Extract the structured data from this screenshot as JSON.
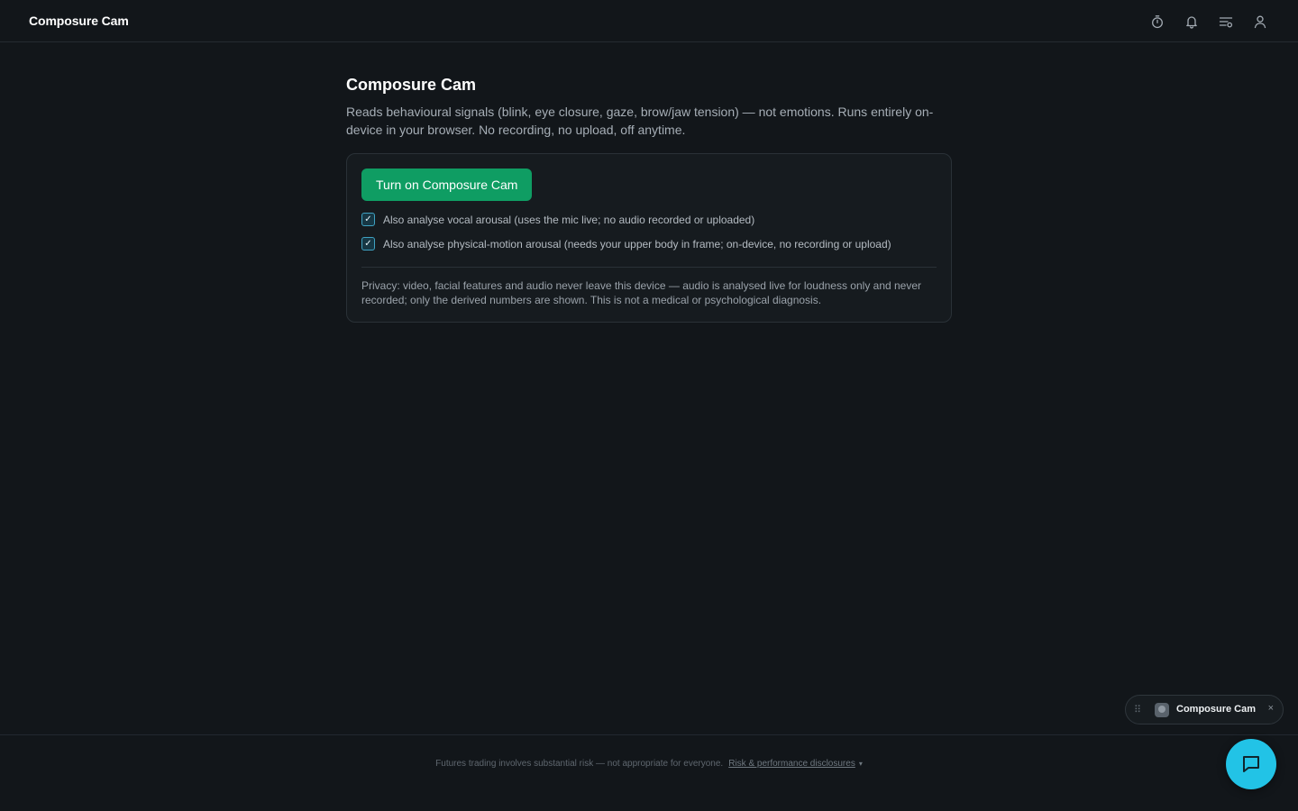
{
  "header": {
    "app_title": "Composure Cam",
    "icons": [
      "timer-icon",
      "bell-icon",
      "list-settings-icon",
      "user-icon"
    ]
  },
  "main": {
    "title": "Composure Cam",
    "description": "Reads behavioural signals (blink, eye closure, gaze, brow/jaw tension) — not emotions. Runs entirely on-device in your browser. No recording, no upload, off anytime.",
    "cta_label": "Turn on Composure Cam",
    "options": [
      {
        "label": "Also analyse vocal arousal (uses the mic live; no audio recorded or uploaded)",
        "checked": true,
        "mark": "✓"
      },
      {
        "label": "Also analyse physical-motion arousal (needs your upper body in frame; on-device, no recording or upload)",
        "checked": true,
        "mark": "✓"
      }
    ],
    "privacy": "Privacy: video, facial features and audio never leave this device — audio is analysed live for loudness only and never recorded; only the derived numbers are shown. This is not a medical or psychological diagnosis."
  },
  "floating_pill": {
    "drag_glyph": "⠿",
    "label": "Composure Cam",
    "close": "×"
  },
  "footer": {
    "notice": "Futures trading involves substantial risk — not appropriate for everyone.",
    "link": "Risk & performance disclosures",
    "caret": "▾"
  },
  "colors": {
    "background": "#12161a",
    "accent_green": "#0f9d63",
    "chat_fab": "#22c3e6"
  }
}
